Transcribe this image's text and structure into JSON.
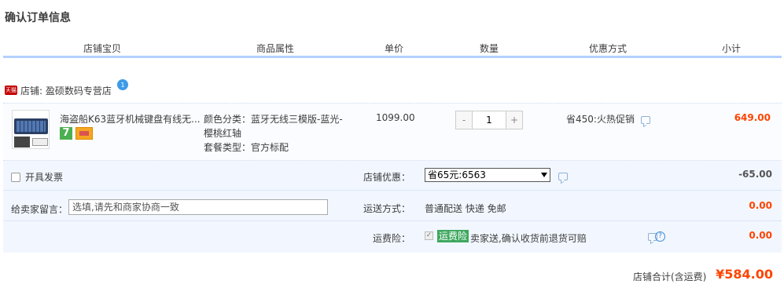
{
  "page": {
    "title": "确认订单信息"
  },
  "columns": [
    "店铺宝贝",
    "商品属性",
    "单价",
    "数量",
    "优惠方式",
    "小计"
  ],
  "shop": {
    "badge": "天猫",
    "label": "店铺: 盈硕数码专营店"
  },
  "item": {
    "title": "海盗船K63蓝牙机械键盘有线无...",
    "badge_7": "7",
    "attr_color": "颜色分类：蓝牙无线三模版-蓝光-",
    "attr_color_cont": "樱桃红轴",
    "attr_package": "套餐类型：官方标配",
    "price": "1099.00",
    "qty_minus": "-",
    "qty_value": "1",
    "qty_plus": "+",
    "promo": "省450:火热促销",
    "subtotal": "649.00"
  },
  "invoice": {
    "label": "开具发票"
  },
  "remark": {
    "label": "给卖家留言：",
    "placeholder": "选填,请先和商家协商一致"
  },
  "shop_discount": {
    "label": "店铺优惠：",
    "selected": "省65元:6563",
    "amount": "-65.00"
  },
  "shipping": {
    "label": "运送方式：",
    "value": "普通配送 快递 免邮",
    "amount": "0.00"
  },
  "insurance": {
    "label": "运费险：",
    "check": "✓",
    "tag": "运费险",
    "text": "卖家送,确认收货前退货可赔",
    "help": "?",
    "amount": "0.00"
  },
  "total": {
    "label": "店铺合计(含运费)",
    "value": "¥584.00"
  },
  "colors": {
    "accent_red": "#ff4400",
    "header_border": "#b2d1ff",
    "panel_bg": "#f2f7ff",
    "insurance_green": "#3ea85f"
  }
}
